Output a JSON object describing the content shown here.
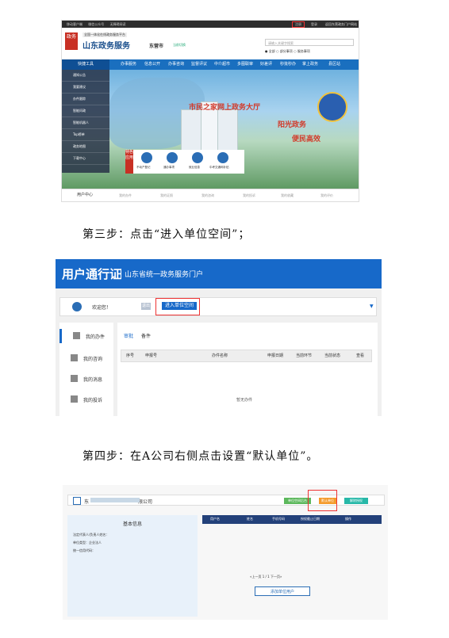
{
  "screenshot1": {
    "topbar": {
      "items": [
        "移动客户端",
        "微信公众号",
        "无障碍阅读"
      ],
      "register": "注册",
      "login": "登录",
      "portal": "返回东营政务门户网站"
    },
    "header": {
      "brand_sub": "全国一体化在线政务服务平台",
      "brand": "山东政务服务",
      "city": "东营市",
      "switch_label": "当前切换",
      "search_placeholder": "请输入关键字搜索",
      "radios": [
        "全部",
        "部分事项",
        "服务事项"
      ]
    },
    "nav": {
      "first": "快捷工具",
      "items": [
        "办事服务",
        "信息公开",
        "办事咨询",
        "监督评议",
        "中介超市",
        "多图联审",
        "好差评",
        "秒批秒办",
        "掌上政务",
        "县区站"
      ]
    },
    "side_menu": [
      "通知公告",
      "我要建议",
      "办件跟踪",
      "智能问政",
      "智能机器人",
      "Top榜单",
      "政务地图",
      "下载中心"
    ],
    "banner": {
      "slogan1": "市民之家网上政务大厅",
      "slogan2": "阳光政务",
      "slogan3": "便民高效"
    },
    "features": {
      "tag": "特色应用",
      "items": [
        "不动产登记",
        "通办事项",
        "就业信息",
        "中考交通网补贴"
      ]
    },
    "bottom_tabs": {
      "first": "用户中心",
      "items": [
        "我的办件",
        "我的证照",
        "我的咨询",
        "我的投诉",
        "我的收藏",
        "我的评价"
      ]
    }
  },
  "caption1": "第三步：点击“进入单位空间”；",
  "screenshot2": {
    "title": "用户通行证",
    "subtitle": "山东省统一政务服务门户",
    "welcome": "欢迎您！",
    "btn_a": "退出",
    "btn_enter": "进入单位空间",
    "menu": [
      "我的办件",
      "我的咨询",
      "我的消息",
      "我的投诉"
    ],
    "tabs": [
      "审批",
      "备件"
    ],
    "table_headers": [
      "序号",
      "申报号",
      "办件名称",
      "申报日期",
      "当前环节",
      "当前状态",
      "查看"
    ],
    "empty": "暂无办件"
  },
  "caption2": "第四步：在A公司右侧点击设置“默认单位”。",
  "screenshot3": {
    "company_prefix": "东",
    "company_suffix": "限公司",
    "btn_green": "单位空间后台",
    "btn_default": "默认单位",
    "btn_teal": "解除授权",
    "info_title": "基本信息",
    "info_lines": [
      "法定代表人/负责人姓名：",
      "单位类型：企业法人",
      "统一信用代码："
    ],
    "grid_headers": [
      "用户名",
      "姓名",
      "手机号码",
      "授权截止日期",
      "操作"
    ],
    "pager": "«上一页  1  /  1  下一页»",
    "add_user": "添加单位用户"
  }
}
